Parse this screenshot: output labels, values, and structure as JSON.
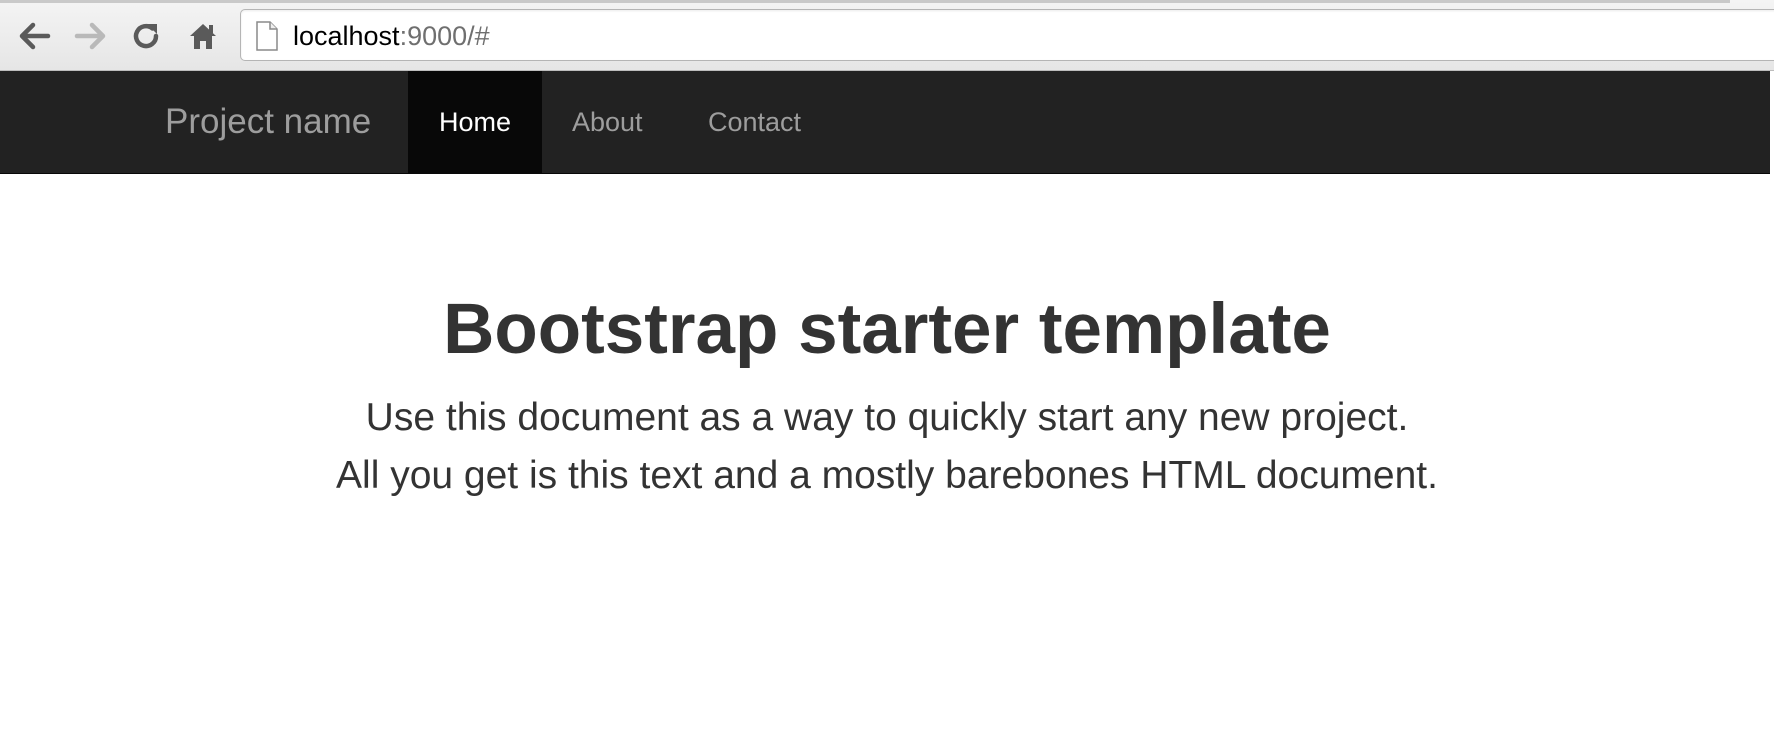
{
  "browser": {
    "url_host": "localhost",
    "url_rest": ":9000/#",
    "buttons": {
      "back": "back-arrow-icon",
      "forward": "forward-arrow-icon",
      "reload": "reload-icon",
      "home": "home-icon"
    },
    "forward_enabled": false,
    "page_icon": "page-icon"
  },
  "navbar": {
    "brand": "Project name",
    "items": [
      {
        "label": "Home",
        "active": true
      },
      {
        "label": "About",
        "active": false
      },
      {
        "label": "Contact",
        "active": false
      }
    ],
    "colors": {
      "background": "#222222",
      "active_background": "#080808",
      "text": "#9d9d9d",
      "active_text": "#ffffff"
    }
  },
  "hero": {
    "title": "Bootstrap starter template",
    "lead_lines": [
      "Use this document as a way to quickly start any new project.",
      "All you get is this text and a mostly barebones HTML document."
    ],
    "text_color": "#333333"
  }
}
